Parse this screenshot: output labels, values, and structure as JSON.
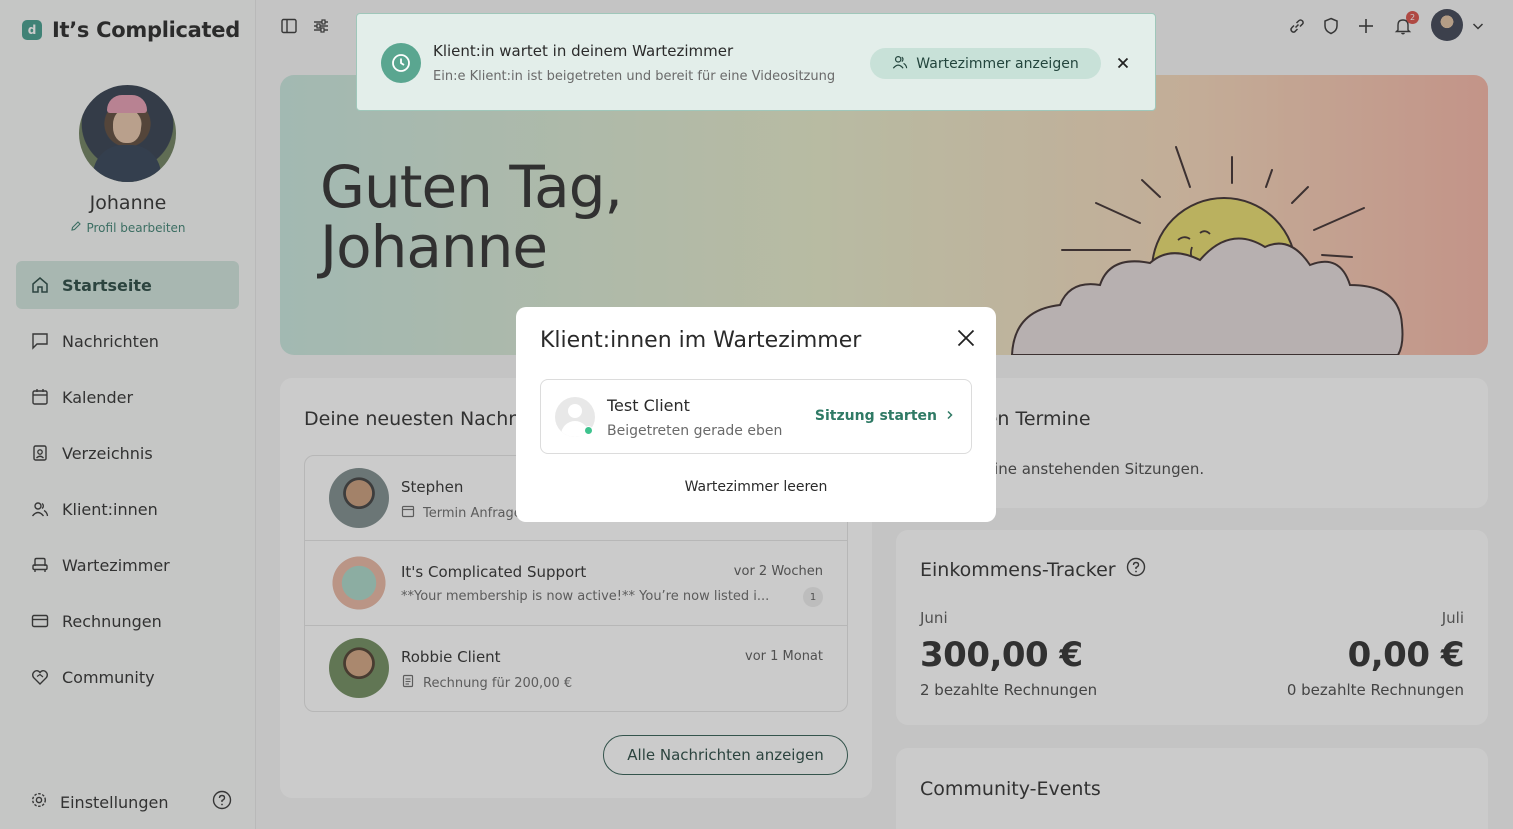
{
  "app": {
    "logo_letter": "d",
    "name": "It’s Complicated"
  },
  "profile": {
    "name": "Johanne",
    "edit_label": "Profil bearbeiten"
  },
  "nav": {
    "items": [
      {
        "label": "Startseite",
        "icon": "home-icon",
        "active": true
      },
      {
        "label": "Nachrichten",
        "icon": "message-icon"
      },
      {
        "label": "Kalender",
        "icon": "calendar-icon"
      },
      {
        "label": "Verzeichnis",
        "icon": "directory-icon"
      },
      {
        "label": "Klient:innen",
        "icon": "users-icon"
      },
      {
        "label": "Wartezimmer",
        "icon": "waiting-room-icon"
      },
      {
        "label": "Rechnungen",
        "icon": "invoice-icon"
      },
      {
        "label": "Community",
        "icon": "community-icon"
      }
    ],
    "settings_label": "Einstellungen"
  },
  "topbar": {
    "notification_count": "2"
  },
  "hero": {
    "greeting_line1": "Guten Tag,",
    "greeting_line2": "Johanne"
  },
  "messages": {
    "title": "Deine neuesten Nachrichten",
    "items": [
      {
        "name": "Stephen",
        "time": "",
        "preview": "Termin Anfrage",
        "count": ""
      },
      {
        "name": "It's Complicated Support",
        "time": "vor 2 Wochen",
        "preview": "**Your membership is now active!** You’re now listed i...",
        "count": "1"
      },
      {
        "name": "Robbie Client",
        "time": "vor 1 Monat",
        "preview": "Rechnung für 200,00 €",
        "count": ""
      }
    ],
    "all_button": "Alle Nachrichten anzeigen"
  },
  "termine": {
    "title": "Nächsten Termine",
    "empty_text": "Aktuell keine anstehenden Sitzungen."
  },
  "income": {
    "title": "Einkommens-Tracker",
    "left": {
      "month": "Juni",
      "amount": "300,00 €",
      "sub": "2 bezahlte Rechnungen"
    },
    "right": {
      "month": "Juli",
      "amount": "0,00 €",
      "sub": "0 bezahlte Rechnungen"
    }
  },
  "events": {
    "title": "Community-Events"
  },
  "toast": {
    "title": "Klient:in wartet in deinem Wartezimmer",
    "subtitle": "Ein:e Klient:in ist beigetreten und bereit für eine Videositzung",
    "button": "Wartezimmer anzeigen"
  },
  "modal": {
    "title": "Klient:innen im Wartezimmer",
    "client_name": "Test Client",
    "client_status": "Beigetreten gerade eben",
    "start_label": "Sitzung starten",
    "clear_label": "Wartezimmer leeren"
  },
  "colors": {
    "accent": "#3f9a8a",
    "active_nav": "#cfe3dc",
    "notification": "#d84b43",
    "online": "#3ec38e"
  }
}
